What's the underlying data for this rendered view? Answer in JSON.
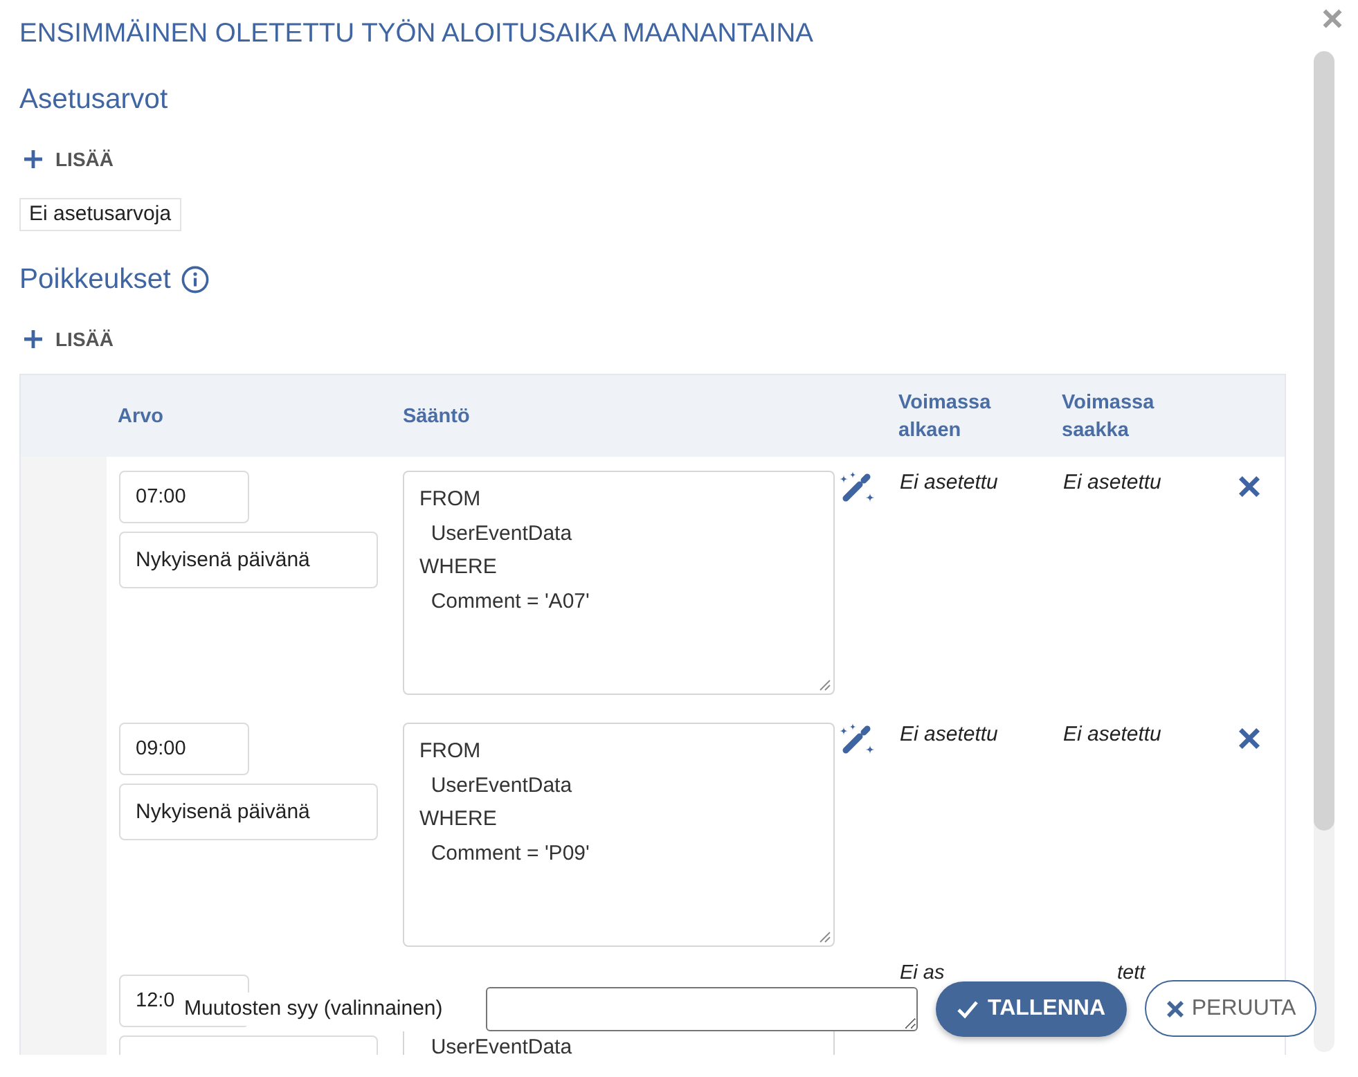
{
  "dialog": {
    "title": "ENSIMMÄINEN OLETETTU TYÖN ALOITUSAIKA MAANANTAINA"
  },
  "settings": {
    "heading": "Asetusarvot",
    "add_label": "LISÄÄ",
    "empty_text": "Ei asetusarvoja"
  },
  "exceptions": {
    "heading": "Poikkeukset",
    "add_label": "LISÄÄ",
    "table": {
      "columns": [
        "Arvo",
        "Sääntö",
        "Voimassa alkaen",
        "Voimassa saakka"
      ],
      "rows": [
        {
          "kind": "full",
          "time": "07:00",
          "day": "Nykyisenä päivänä",
          "rule": "FROM\n  UserEventData\nWHERE\n  Comment = 'A07'",
          "valid_from": "Ei asetettu",
          "valid_to": "Ei asetettu"
        },
        {
          "kind": "full",
          "time": "09:00",
          "day": "Nykyisenä päivänä",
          "rule": "FROM\n  UserEventData\nWHERE\n  Comment = 'P09'",
          "valid_from": "Ei asetettu",
          "valid_to": "Ei asetettu"
        },
        {
          "kind": "covered",
          "time": "12:0",
          "rule": "  UserEventData",
          "valid_from": "Ei as",
          "valid_to": "tett"
        }
      ]
    }
  },
  "footer": {
    "reason_label": "Muutosten syy (valinnainen)",
    "save_label": "TALLENNA",
    "cancel_label": "PERUUTA"
  }
}
